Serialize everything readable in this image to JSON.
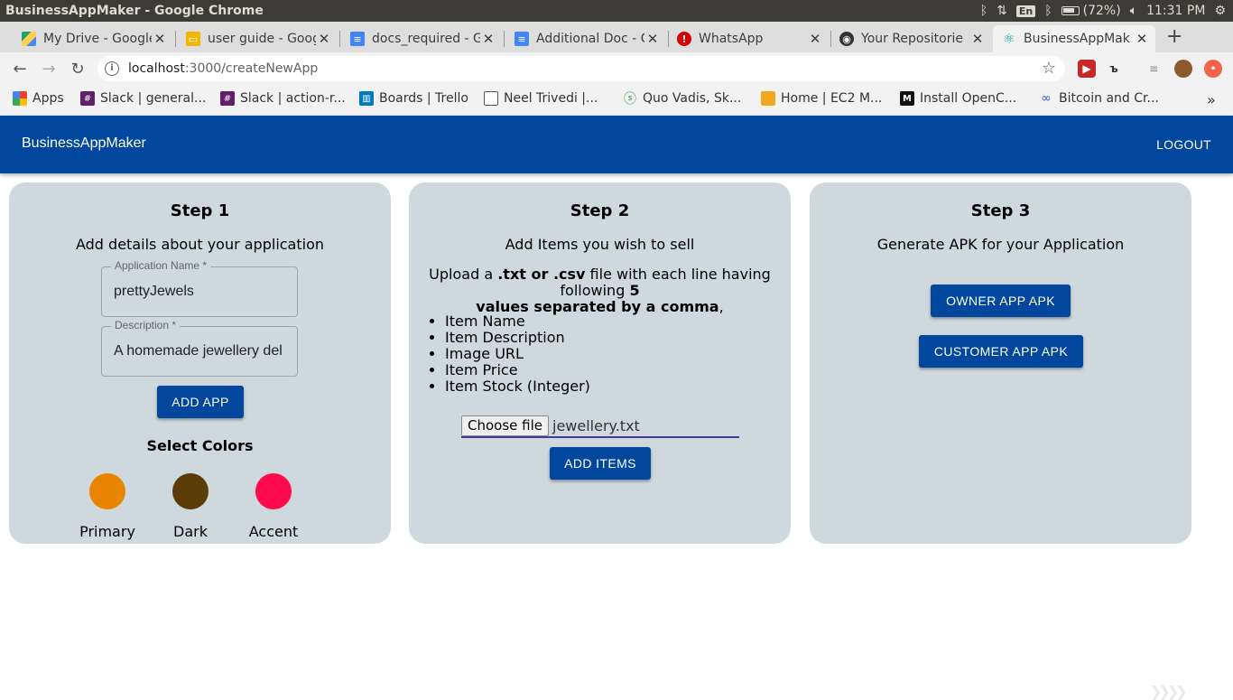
{
  "os": {
    "window_title": "BusinessAppMaker - Google Chrome",
    "lang": "En",
    "battery": "(72%)",
    "time": "11:31 PM"
  },
  "tabs": [
    {
      "label": "My Drive - Google",
      "icon": "google-drive-icon"
    },
    {
      "label": "user guide - Goog",
      "icon": "google-slides-icon"
    },
    {
      "label": "docs_required - G",
      "icon": "google-docs-icon"
    },
    {
      "label": "Additional Doc - G",
      "icon": "google-docs-icon"
    },
    {
      "label": "WhatsApp",
      "icon": "whatsapp-alert-icon"
    },
    {
      "label": "Your Repositorie",
      "icon": "github-icon"
    },
    {
      "label": "BusinessAppMak",
      "icon": "react-icon"
    }
  ],
  "address": {
    "host": "localhost",
    "path": ":3000/createNewApp"
  },
  "bookmarks": [
    {
      "label": "Apps",
      "icon": "apps-grid-icon"
    },
    {
      "label": "Slack | general...",
      "icon": "slack-icon"
    },
    {
      "label": "Slack | action-r...",
      "icon": "slack-icon"
    },
    {
      "label": "Boards | Trello",
      "icon": "trello-icon"
    },
    {
      "label": "Neel Trivedi |...",
      "icon": "page-icon"
    },
    {
      "label": "Quo Vadis, Sk...",
      "icon": "leaf-icon"
    },
    {
      "label": "Home | EC2 M...",
      "icon": "aws-box-icon"
    },
    {
      "label": "Install OpenC...",
      "icon": "medium-icon"
    },
    {
      "label": "Bitcoin and Cr...",
      "icon": "link-icon"
    }
  ],
  "appbar": {
    "brand": "BusinessAppMaker",
    "logout": "LOGOUT"
  },
  "step1": {
    "title": "Step 1",
    "subtitle": "Add details about your application",
    "app_name_label": "Application Name *",
    "app_name_value": "prettyJewels",
    "description_label": "Description *",
    "description_value": "A homemade jewellery del",
    "add_app_button": "ADD APP",
    "colors_title": "Select Colors",
    "colors": [
      {
        "label": "Primary",
        "color": "#e88400"
      },
      {
        "label": "Dark",
        "color": "#5c3c06"
      },
      {
        "label": "Accent",
        "color": "#ff0a4f"
      }
    ]
  },
  "step2": {
    "title": "Step 2",
    "subtitle": "Add Items you wish to sell",
    "upload_text_1": "Upload a ",
    "upload_bold_1": ".txt or .csv",
    "upload_text_2": " file with each line having following ",
    "upload_bold_2": "5",
    "upload_bold_3": "values separated by a comma",
    "upload_text_3": ",",
    "requirements": [
      "Item Name",
      "Item Description",
      "Image URL",
      "Item Price",
      "Item Stock (Integer)"
    ],
    "choose_file_button": "Choose file",
    "file_name": "jewellery.txt",
    "add_items_button": "ADD ITEMS"
  },
  "step3": {
    "title": "Step 3",
    "subtitle": "Generate APK for your Application",
    "owner_button": "OWNER APP APK",
    "customer_button": "CUSTOMER APP APK"
  },
  "theme": {
    "primary": "#01479d",
    "card_bg": "#cfd8dc"
  }
}
